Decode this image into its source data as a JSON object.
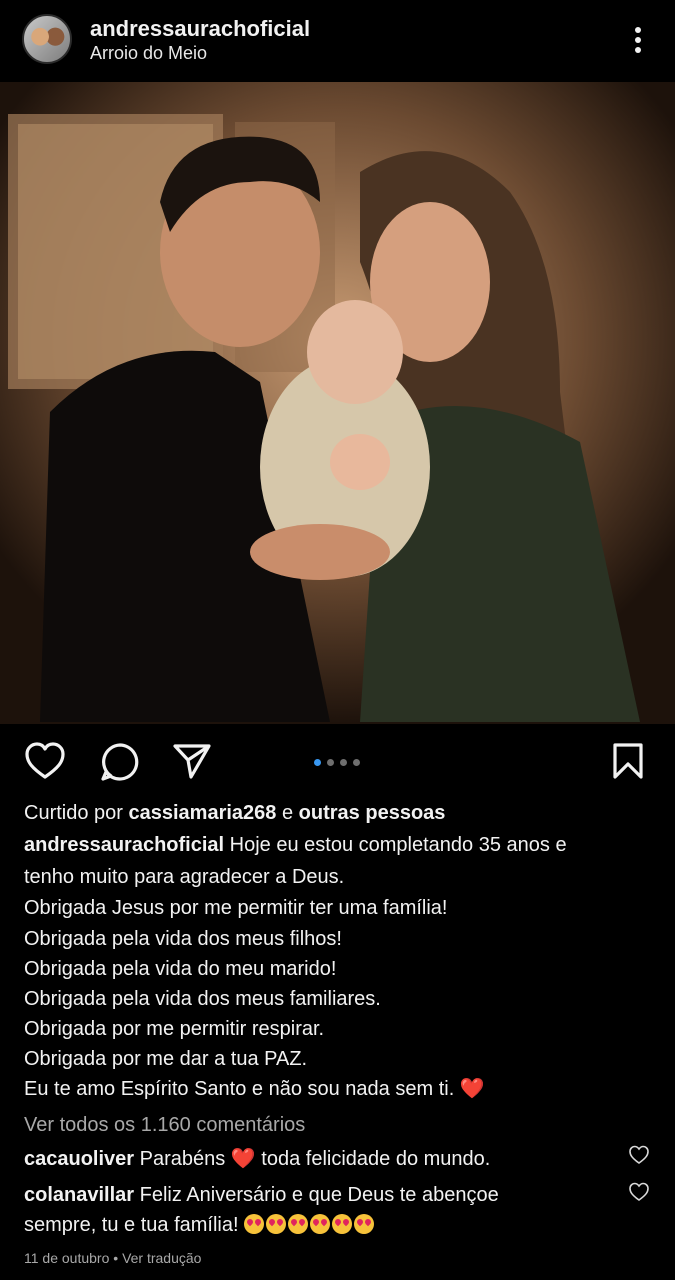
{
  "post": {
    "username": "andressaurachoficial",
    "location": "Arroio do Meio"
  },
  "carousel": {
    "count": 4,
    "active": 1
  },
  "likes": {
    "prefix": "Curtido por",
    "user": "cassiamaria268",
    "connector": "e",
    "others": "outras pessoas"
  },
  "caption": {
    "author": "andressaurachoficial",
    "lines": [
      "Hoje eu estou completando 35 anos e",
      "tenho muito para agradecer a Deus.",
      "Obrigada Jesus por me permitir ter uma família!",
      "Obrigada pela vida dos meus filhos!",
      "Obrigada pela vida do meu marido!",
      "Obrigada pela vida dos meus familiares.",
      "Obrigada por me permitir respirar.",
      "Obrigada por me dar a tua PAZ.",
      "Eu te amo Espírito Santo e não sou nada sem ti."
    ],
    "end_emoji": "❤️"
  },
  "view_comments": "Ver todos os 1.160 comentários",
  "comments": [
    {
      "user": "cacauoliver",
      "text_before": "Parabéns",
      "emoji": "❤️",
      "text_after": "toda felicidade do mundo."
    },
    {
      "user": "colanavillar",
      "line1": "Feliz Aniversário e que Deus te abençoe",
      "line2": "sempre, tu e tua família!",
      "emoji_count": 6
    }
  ],
  "footer": {
    "date": "11 de outubro",
    "separator": "•",
    "translate": "Ver tradução"
  },
  "colors": {
    "background": "#000000",
    "text": "#f2f2f2",
    "muted": "#a8a8a8",
    "carousel_active": "#3897f0",
    "heart": "#e0245e"
  },
  "icons": [
    "more-vertical-icon",
    "heart-icon",
    "comment-icon",
    "share-icon",
    "bookmark-icon",
    "small-heart-icon"
  ]
}
